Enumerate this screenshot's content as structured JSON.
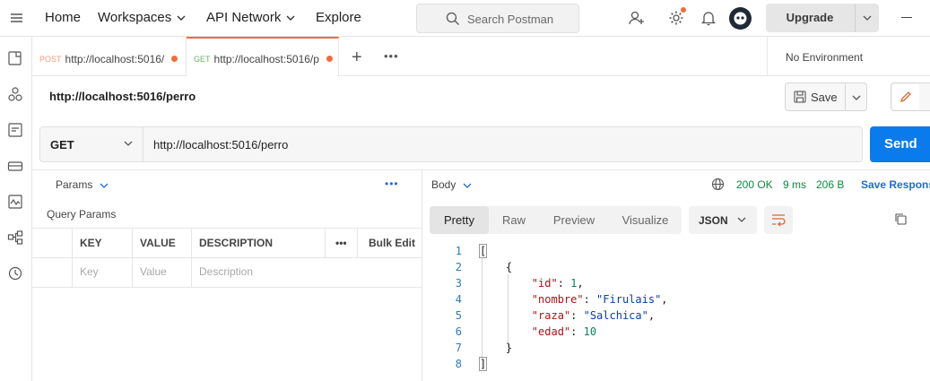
{
  "topbar": {
    "nav": [
      "Home",
      "Workspaces",
      "API Network",
      "Explore"
    ],
    "search_placeholder": "Search Postman",
    "upgrade_label": "Upgrade"
  },
  "tabs": [
    {
      "method": "POST",
      "url": "http://localhost:5016/",
      "unsaved": true
    },
    {
      "method": "GET",
      "url": "http://localhost:5016/p",
      "unsaved": true,
      "active": true
    }
  ],
  "environment": "No Environment",
  "request": {
    "title": "http://localhost:5016/perro",
    "save_label": "Save",
    "method": "GET",
    "url": "http://localhost:5016/perro",
    "send_label": "Send"
  },
  "params": {
    "dropdown_label": "Params",
    "section_title": "Query Params",
    "headers": [
      "KEY",
      "VALUE",
      "DESCRIPTION",
      "Bulk Edit"
    ],
    "placeholders": [
      "Key",
      "Value",
      "Description"
    ]
  },
  "response": {
    "dropdown_label": "Body",
    "status": "200 OK",
    "time": "9 ms",
    "size": "206 B",
    "save_label": "Save Respons",
    "view_tabs": [
      "Pretty",
      "Raw",
      "Preview",
      "Visualize"
    ],
    "active_view": "Pretty",
    "format": "JSON",
    "lines": [
      {
        "n": "1",
        "text": "["
      },
      {
        "n": "2",
        "text": "    {"
      },
      {
        "n": "3",
        "key": "\"id\"",
        "val": "1",
        "type": "num",
        "comma": true
      },
      {
        "n": "4",
        "key": "\"nombre\"",
        "val": "\"Firulais\"",
        "type": "str",
        "comma": true
      },
      {
        "n": "5",
        "key": "\"raza\"",
        "val": "\"Salchica\"",
        "type": "str",
        "comma": true
      },
      {
        "n": "6",
        "key": "\"edad\"",
        "val": "10",
        "type": "num",
        "comma": false
      },
      {
        "n": "7",
        "text": "    }"
      },
      {
        "n": "8",
        "text": "]"
      }
    ]
  },
  "colors": {
    "accent": "#f26b3a",
    "send": "#097bed",
    "status_ok": "#0b8a3f",
    "link": "#1f6dd1"
  }
}
